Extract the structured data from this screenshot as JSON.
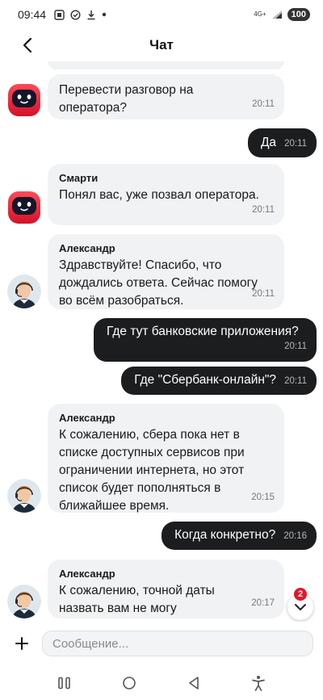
{
  "status_bar": {
    "time": "09:44",
    "network": "4G+",
    "battery": "100"
  },
  "header": {
    "title": "Чат"
  },
  "messages": [
    {
      "id": "m1",
      "direction": "in",
      "sender": "",
      "avatar": "robot",
      "text": "Перевести разговор на оператора?",
      "time": "20:11"
    },
    {
      "id": "m2",
      "direction": "out",
      "text": "Да",
      "time": "20:11"
    },
    {
      "id": "m3",
      "direction": "in",
      "sender": "Смарти",
      "avatar": "robot",
      "text": "Понял вас, уже позвал оператора.",
      "time": "20:11"
    },
    {
      "id": "m4",
      "direction": "in",
      "sender": "Александр",
      "avatar": "operator",
      "text": "Здравствуйте! Спасибо, что дождались ответа. Сейчас помогу во всём разобраться.",
      "time": "20:11"
    },
    {
      "id": "m5",
      "direction": "out",
      "text": "Где тут банковские приложения?",
      "time": "20:11"
    },
    {
      "id": "m6",
      "direction": "out",
      "text": "Где \"Сбербанк-онлайн\"?",
      "time": "20:11"
    },
    {
      "id": "m7",
      "direction": "in",
      "sender": "Александр",
      "avatar": "operator",
      "text": "К сожалению, сбера пока нет в списке доступных сервисов при ограничении интернета, но этот список будет пополняться в ближайшее время.",
      "time": "20:15"
    },
    {
      "id": "m8",
      "direction": "out",
      "text": "Когда конкретно?",
      "time": "20:16"
    },
    {
      "id": "m9",
      "direction": "in",
      "sender": "Александр",
      "avatar": "operator",
      "text": "К сожалению, точной даты назвать вам не могу",
      "time": "20:17"
    }
  ],
  "scroll_down": {
    "unread_count": "2"
  },
  "input": {
    "placeholder": "Сообщение..."
  },
  "colors": {
    "outgoing_bubble": "#1c1d1f",
    "incoming_bubble": "#f1f2f4",
    "badge": "#e4162a",
    "bot_red": "#e8202f"
  }
}
